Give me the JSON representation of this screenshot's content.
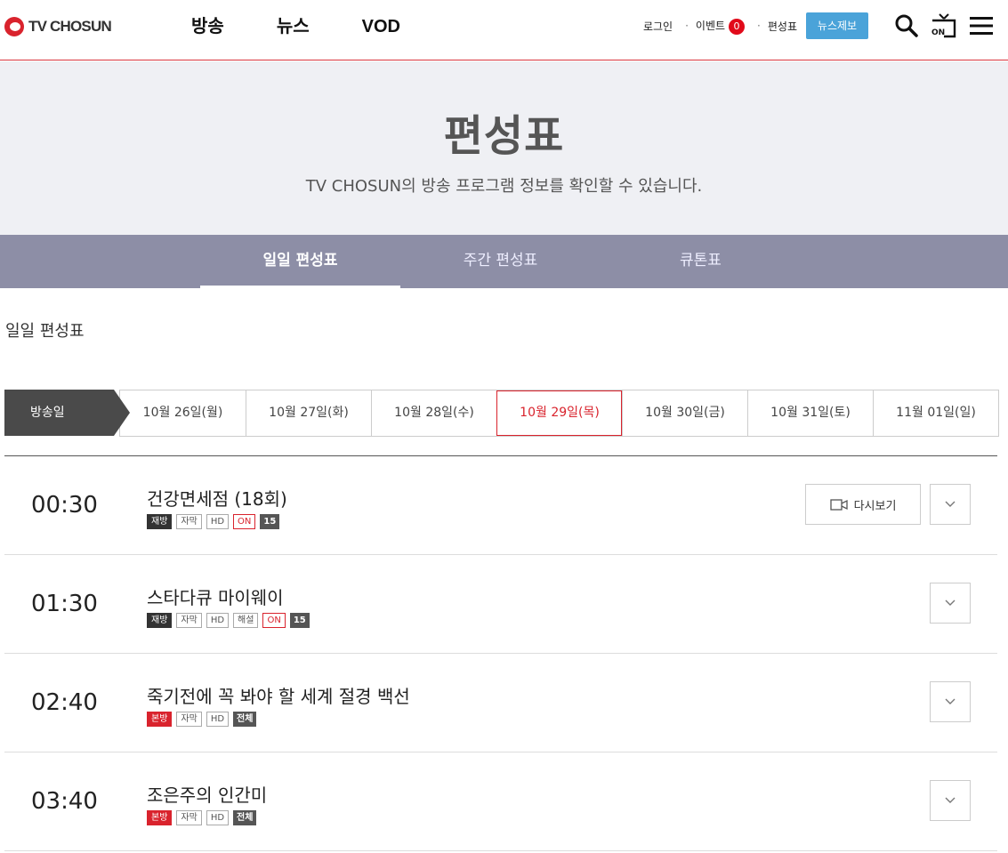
{
  "header": {
    "logo_text": "TV CHOSUN",
    "nav": [
      "방송",
      "뉴스",
      "VOD"
    ],
    "util": {
      "login": "로그인",
      "event": "이벤트",
      "event_count": "0",
      "schedule": "편성표",
      "news_tip": "뉴스제보"
    },
    "icons": [
      "search-icon",
      "tv-on-icon",
      "menu-icon"
    ]
  },
  "title_area": {
    "title": "편성표",
    "subtitle": "TV CHOSUN의 방송 프로그램 정보를 확인할 수 있습니다."
  },
  "tabs": [
    {
      "label": "일일 편성표",
      "active": true
    },
    {
      "label": "주간 편성표",
      "active": false
    },
    {
      "label": "큐톤표",
      "active": false
    }
  ],
  "section_title": "일일 편성표",
  "date_strip": {
    "label": "방송일",
    "dates": [
      "10월 26일(월)",
      "10월 27일(화)",
      "10월 28일(수)",
      "10월 29일(목)",
      "10월 30일(금)",
      "10월 31일(토)",
      "11월 01일(일)"
    ],
    "selected_index": 3
  },
  "programs": [
    {
      "time": "00:30",
      "title": "건강면세점 (18회)",
      "tags": [
        {
          "text": "재방",
          "style": "dark"
        },
        {
          "text": "자막",
          "style": "plain"
        },
        {
          "text": "HD",
          "style": "plain"
        },
        {
          "text": "ON",
          "style": "on"
        },
        {
          "text": "15",
          "style": "age"
        }
      ],
      "replay_label": "다시보기"
    },
    {
      "time": "01:30",
      "title": "스타다큐 마이웨이",
      "tags": [
        {
          "text": "재방",
          "style": "dark"
        },
        {
          "text": "자막",
          "style": "plain"
        },
        {
          "text": "HD",
          "style": "plain"
        },
        {
          "text": "해설",
          "style": "plain"
        },
        {
          "text": "ON",
          "style": "on"
        },
        {
          "text": "15",
          "style": "age"
        }
      ]
    },
    {
      "time": "02:40",
      "title": "죽기전에 꼭 봐야 할 세계 절경 백선",
      "tags": [
        {
          "text": "본방",
          "style": "red"
        },
        {
          "text": "자막",
          "style": "plain"
        },
        {
          "text": "HD",
          "style": "plain"
        },
        {
          "text": "전체",
          "style": "age"
        }
      ]
    },
    {
      "time": "03:40",
      "title": "조은주의 인간미",
      "tags": [
        {
          "text": "본방",
          "style": "red"
        },
        {
          "text": "자막",
          "style": "plain"
        },
        {
          "text": "HD",
          "style": "plain"
        },
        {
          "text": "전체",
          "style": "age"
        }
      ]
    }
  ],
  "colors": {
    "brand_red": "#d9232d",
    "tab_bar": "#8d8ea6",
    "title_bg": "#eff0f4",
    "news_tip_blue": "#4aa3d9"
  }
}
